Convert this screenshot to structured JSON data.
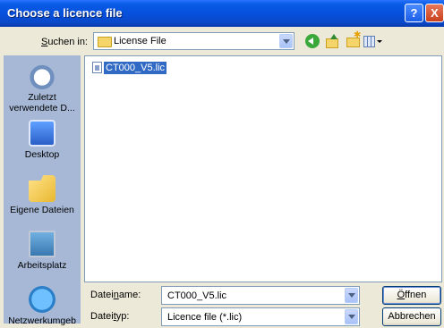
{
  "window": {
    "title": "Choose a licence file",
    "help_glyph": "?",
    "close_glyph": "X"
  },
  "lookin": {
    "label_pre": "",
    "label_key": "S",
    "label_post": "uchen in:",
    "value": "License File"
  },
  "toolbar": {
    "icons": [
      "back-icon",
      "up-folder-icon",
      "new-folder-icon",
      "views-menu-icon"
    ]
  },
  "places": [
    {
      "label": "Zuletzt verwendete D...",
      "icon": "recent-documents-icon"
    },
    {
      "label": "Desktop",
      "icon": "desktop-icon"
    },
    {
      "label": "Eigene Dateien",
      "icon": "my-documents-icon"
    },
    {
      "label": "Arbeitsplatz",
      "icon": "my-computer-icon"
    },
    {
      "label": "Netzwerkumgeb",
      "icon": "network-icon"
    }
  ],
  "files": [
    {
      "name": "CT000_V5.lic",
      "selected": true
    }
  ],
  "filename": {
    "label_pre": "Datei",
    "label_key": "n",
    "label_post": "ame:",
    "value": "CT000_V5.lic"
  },
  "filetype": {
    "label_pre": "Datei",
    "label_key": "t",
    "label_post": "yp:",
    "value": "Licence file (*.lic)"
  },
  "buttons": {
    "open_key": "Ö",
    "open_rest": "ffnen",
    "cancel": "Abbrechen"
  }
}
